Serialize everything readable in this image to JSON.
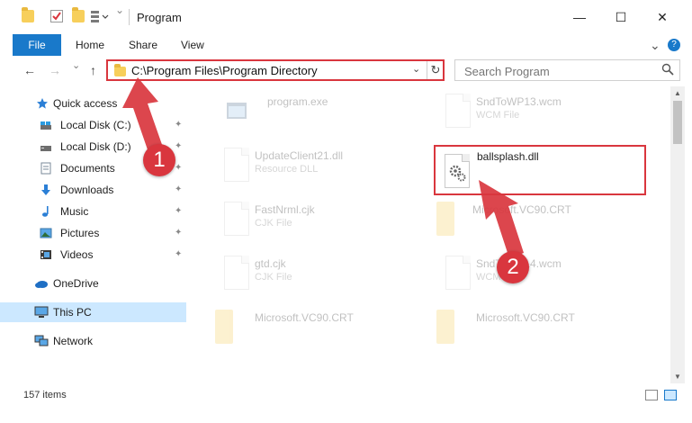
{
  "window": {
    "title": "Program",
    "minimize": "—",
    "maximize": "☐",
    "close": "✕"
  },
  "ribbon": {
    "tabs": [
      "File",
      "Home",
      "Share",
      "View"
    ],
    "collapse": "⌄",
    "help": "?"
  },
  "nav": {
    "back": "←",
    "forward": "→",
    "up": "↑",
    "recent": "⌄"
  },
  "address": {
    "path": "C:\\Program Files\\Program Directory",
    "dropdown": "⌄",
    "refresh": "↻"
  },
  "search": {
    "placeholder": "Search Program"
  },
  "sidebar": {
    "items": [
      {
        "label": "Quick access",
        "icon": "star-icon",
        "pinned": false
      },
      {
        "label": "Local Disk (C:)",
        "icon": "drive-icon",
        "pinned": true
      },
      {
        "label": "Local Disk (D:)",
        "icon": "drive-icon",
        "pinned": true
      },
      {
        "label": "Documents",
        "icon": "documents-icon",
        "pinned": true
      },
      {
        "label": "Downloads",
        "icon": "download-icon",
        "pinned": true
      },
      {
        "label": "Music",
        "icon": "music-icon",
        "pinned": true
      },
      {
        "label": "Pictures",
        "icon": "pictures-icon",
        "pinned": true
      },
      {
        "label": "Videos",
        "icon": "videos-icon",
        "pinned": true
      },
      {
        "label": "OneDrive",
        "icon": "cloud-icon",
        "pinned": false
      },
      {
        "label": "This PC",
        "icon": "computer-icon",
        "pinned": false
      },
      {
        "label": "Network",
        "icon": "network-icon",
        "pinned": false
      }
    ],
    "pin_glyph": "📌"
  },
  "files": [
    {
      "name": "program.exe",
      "type": "",
      "icon": "exe-icon"
    },
    {
      "name": "SndToWP13.wcm",
      "type": "WCM File",
      "icon": "file-icon"
    },
    {
      "name": "UpdateClient21.dll",
      "type": "Resource DLL",
      "icon": "dll-icon"
    },
    {
      "name": "ballsplash.dll",
      "type": "",
      "icon": "dll-gear-icon"
    },
    {
      "name": "FastNrml.cjk",
      "type": "CJK File",
      "icon": "file-icon"
    },
    {
      "name": "Microsoft.VC90.CRT",
      "type": "",
      "icon": "folder-icon"
    },
    {
      "name": "gtd.cjk",
      "type": "CJK File",
      "icon": "file-icon"
    },
    {
      "name": "SndToWP14.wcm",
      "type": "WCM File",
      "icon": "file-icon"
    },
    {
      "name": "Microsoft.VC90.CRT",
      "type": "",
      "icon": "folder-icon"
    },
    {
      "name": "Microsoft.VC90.CRT",
      "type": "",
      "icon": "folder-icon"
    }
  ],
  "status": {
    "count": "157 items"
  },
  "annotations": {
    "step1": "1",
    "step2": "2"
  },
  "colors": {
    "accent": "#1979ca",
    "highlight": "#d9363e",
    "selected": "#cce8ff"
  }
}
